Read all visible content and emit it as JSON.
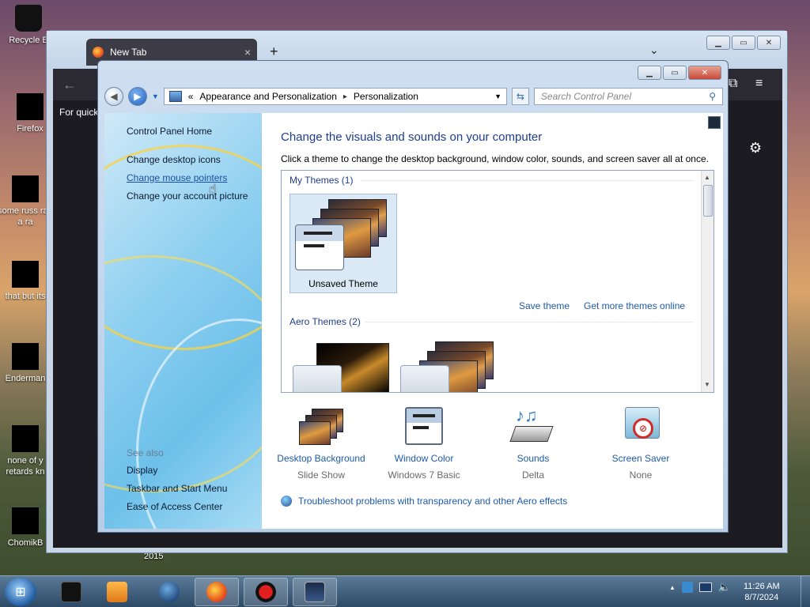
{
  "desktop": {
    "icons": [
      {
        "label": "Recycle B"
      },
      {
        "label": "Firefox"
      },
      {
        "label": "some russ ran a ra"
      },
      {
        "label": "that but its"
      },
      {
        "label": "Enderman"
      },
      {
        "label": "none of y retards kn"
      },
      {
        "label": "ChomikB"
      }
    ],
    "stray_label": "2015"
  },
  "firefox": {
    "tab_title": "New Tab",
    "tab_close": "×",
    "new_tab": "+",
    "list_tabs": "⌄",
    "quick_text": "For quick",
    "back": "←",
    "menu": "≡"
  },
  "control_panel": {
    "breadcrumb": {
      "chevrons": "«",
      "items": [
        "Appearance and Personalization",
        "Personalization"
      ],
      "separator": "▸"
    },
    "search_placeholder": "Search Control Panel",
    "sidebar": {
      "home": "Control Panel Home",
      "links": [
        "Change desktop icons",
        "Change mouse pointers",
        "Change your account picture"
      ],
      "see_also_title": "See also",
      "see_also": [
        "Display",
        "Taskbar and Start Menu",
        "Ease of Access Center"
      ]
    },
    "main": {
      "heading": "Change the visuals and sounds on your computer",
      "subheading": "Click a theme to change the desktop background, window color, sounds, and screen saver all at once.",
      "my_themes_title": "My Themes (1)",
      "unsaved_theme": "Unsaved Theme",
      "save_theme": "Save theme",
      "get_more_themes": "Get more themes online",
      "aero_themes_title": "Aero Themes (2)",
      "options": [
        {
          "title": "Desktop Background",
          "subtitle": "Slide Show",
          "icon": "desktop-background-icon"
        },
        {
          "title": "Window Color",
          "subtitle": "Windows 7 Basic",
          "icon": "window-color-icon"
        },
        {
          "title": "Sounds",
          "subtitle": "Delta",
          "icon": "sounds-icon"
        },
        {
          "title": "Screen Saver",
          "subtitle": "None",
          "icon": "screen-saver-icon"
        }
      ],
      "troubleshoot": "Troubleshoot problems with transparency and other Aero effects"
    }
  },
  "taskbar": {
    "clock_time": "11:26 AM",
    "clock_date": "8/7/2024",
    "tray_arrow": "▲"
  },
  "colors": {
    "link": "#1e5aa8",
    "heading": "#1e3d8c",
    "taskbar": "#2d4a66"
  }
}
